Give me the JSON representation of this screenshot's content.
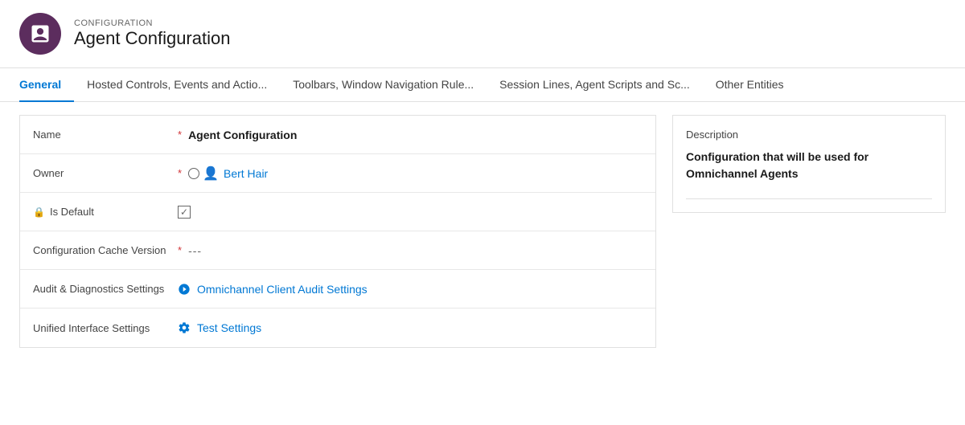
{
  "header": {
    "label": "CONFIGURATION",
    "title": "Agent Configuration",
    "icon_label": "agent-config-icon"
  },
  "tabs": [
    {
      "id": "general",
      "label": "General",
      "active": true
    },
    {
      "id": "hosted-controls",
      "label": "Hosted Controls, Events and Actio...",
      "active": false
    },
    {
      "id": "toolbars",
      "label": "Toolbars, Window Navigation Rule...",
      "active": false
    },
    {
      "id": "session-lines",
      "label": "Session Lines, Agent Scripts and Sc...",
      "active": false
    },
    {
      "id": "other-entities",
      "label": "Other Entities",
      "active": false
    }
  ],
  "form": {
    "rows": [
      {
        "id": "name",
        "label": "Name",
        "required": true,
        "value": "Agent Configuration",
        "type": "text-bold",
        "has_lock": false
      },
      {
        "id": "owner",
        "label": "Owner",
        "required": true,
        "value": "Bert Hair",
        "type": "owner",
        "has_lock": false
      },
      {
        "id": "is-default",
        "label": "Is Default",
        "required": false,
        "type": "checkbox",
        "checked": true,
        "has_lock": true
      },
      {
        "id": "config-cache-version",
        "label": "Configuration Cache Version",
        "required": true,
        "value": "---",
        "type": "dashes",
        "has_lock": false
      },
      {
        "id": "audit-diagnostics",
        "label": "Audit & Diagnostics Settings",
        "required": false,
        "value": "Omnichannel Client Audit Settings",
        "type": "link",
        "has_lock": false
      },
      {
        "id": "unified-interface",
        "label": "Unified Interface Settings",
        "required": false,
        "value": "Test Settings",
        "type": "link-settings",
        "has_lock": false
      }
    ]
  },
  "description": {
    "label": "Description",
    "text": "Configuration that will be used for Omnichannel Agents"
  },
  "colors": {
    "accent": "#5c2d5e",
    "link": "#0078d4",
    "required": "#d13438",
    "tab_active": "#0078d4"
  }
}
